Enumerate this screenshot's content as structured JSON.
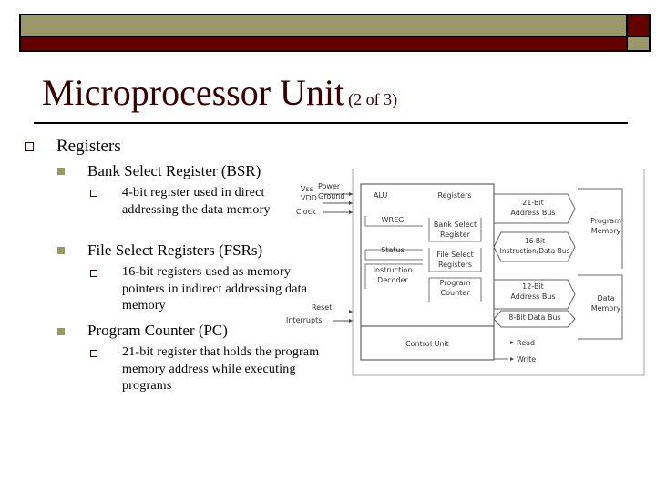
{
  "slide": {
    "title": "Microprocessor Unit",
    "title_suffix": "(2 of 3)",
    "colors": {
      "olive": "#9a9868",
      "maroon": "#640000",
      "title": "#3a0000"
    }
  },
  "content": {
    "level1": "Registers",
    "items": [
      {
        "heading": "Bank Select Register (BSR)",
        "desc_lines": [
          "4-bit register used in direct",
          "addressing the data memory"
        ]
      },
      {
        "heading": "File Select Registers (FSRs)",
        "desc_lines": [
          "16-bit registers used as memory",
          "pointers in indirect addressing data",
          "memory"
        ]
      },
      {
        "heading": "Program Counter (PC)",
        "desc_lines": [
          "21-bit register that holds the program",
          "memory address while executing",
          "programs"
        ]
      }
    ]
  },
  "diagram": {
    "inputs": {
      "vss": "Vss",
      "vdd": "VDD",
      "power": "Power",
      "ground": "Ground",
      "clock": "Clock",
      "reset": "Reset",
      "interrupts": "Interrupts"
    },
    "cpu": {
      "alu": "ALU",
      "registers": "Registers",
      "wreg": "WREG",
      "status": "Status",
      "instruction_decoder": [
        "Instruction",
        "Decoder"
      ],
      "bsr": [
        "Bank Select",
        "Register"
      ],
      "fsr": [
        "File Select",
        "Registers"
      ],
      "pc": [
        "Program",
        "Counter"
      ],
      "control_unit": "Control Unit"
    },
    "buses": {
      "addr21": [
        "21-Bit",
        "Address Bus"
      ],
      "data16": [
        "16-Bit",
        "Instruction/Data Bus"
      ],
      "addr12": [
        "12-Bit",
        "Address Bus"
      ],
      "data8": "8-Bit Data Bus"
    },
    "memories": {
      "program": [
        "Program",
        "Memory"
      ],
      "data": [
        "Data",
        "Memory"
      ]
    },
    "signals": {
      "read": "Read",
      "write": "Write"
    }
  }
}
